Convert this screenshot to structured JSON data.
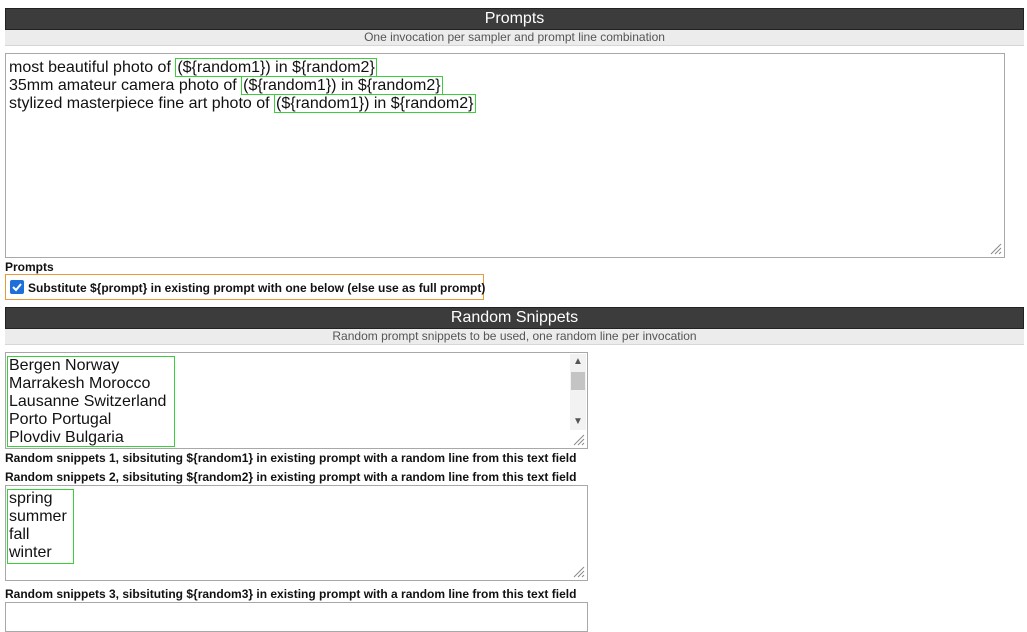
{
  "prompts_section": {
    "title": "Prompts",
    "subtitle": "One invocation per sampler and prompt line combination",
    "lines": [
      {
        "plain": "most beautiful photo of ",
        "highlight": "(${random1}) in ${random2}"
      },
      {
        "plain": "35mm amateur camera photo of ",
        "highlight": "(${random1}) in ${random2}"
      },
      {
        "plain": "stylized masterpiece fine art photo of ",
        "highlight": "(${random1}) in ${random2}"
      }
    ],
    "field_label": "Prompts",
    "checkbox_label": "Substitute ${prompt} in existing prompt with one below (else use as full prompt)",
    "checkbox_checked": true
  },
  "random_section": {
    "title": "Random Snippets",
    "subtitle": "Random prompt snippets to be used, one random line per invocation",
    "snippets1": [
      "Bergen Norway",
      "Marrakesh Morocco",
      "Lausanne Switzerland",
      "Porto Portugal",
      "Plovdiv Bulgaria"
    ],
    "label1": "Random snippets 1, sibsituting ${random1} in existing prompt with a random line from this text field",
    "snippets2": [
      "spring",
      "summer",
      "fall",
      "winter"
    ],
    "label2": "Random snippets 2, sibsituting ${random2} in existing prompt with a random line from this text field",
    "label3": "Random snippets 3, sibsituting ${random3} in existing prompt with a random line from this text field"
  },
  "colors": {
    "header_bg": "#3c3c3c",
    "highlight_border": "#3ccf3c",
    "checkbox_border": "#e89a3c",
    "checkbox_fill": "#1e6fd9"
  }
}
